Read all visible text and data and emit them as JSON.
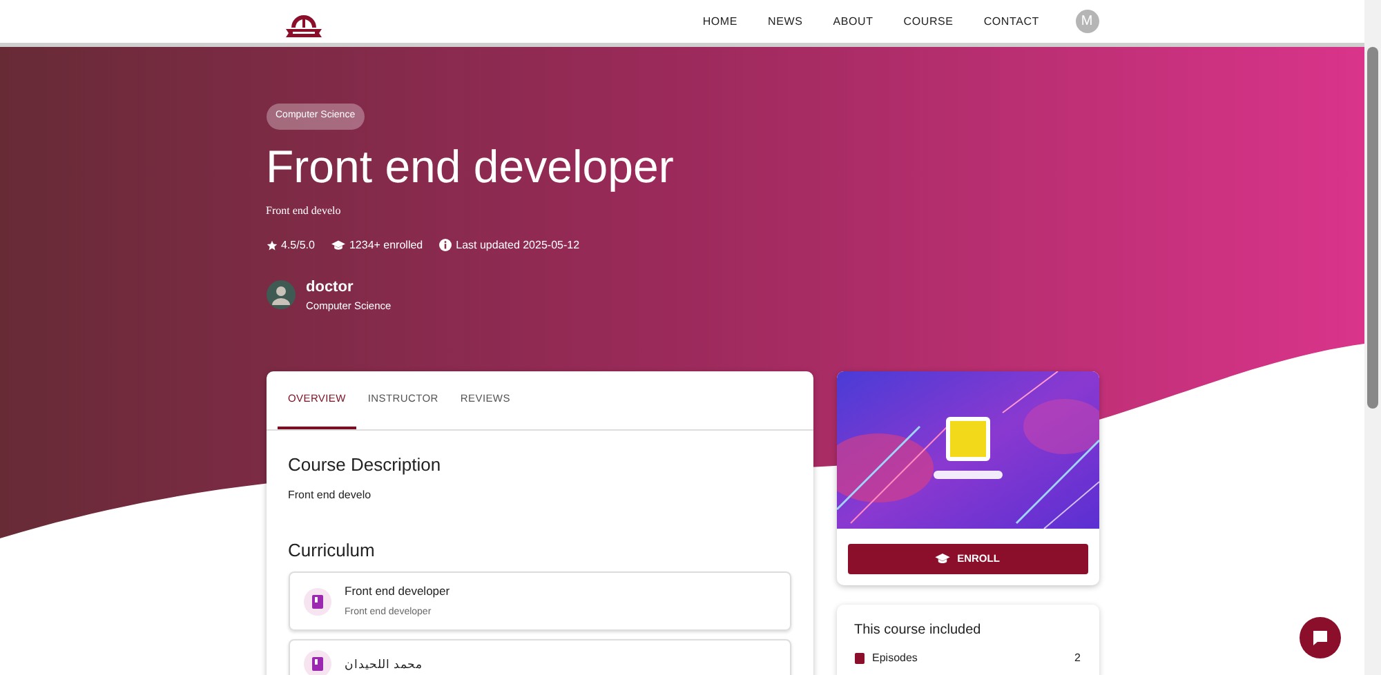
{
  "navbar": {
    "links": [
      {
        "label": "HOME"
      },
      {
        "label": "NEWS"
      },
      {
        "label": "ABOUT"
      },
      {
        "label": "COURSE"
      },
      {
        "label": "CONTACT"
      }
    ],
    "avatar": "M"
  },
  "hero": {
    "category": "Computer Science",
    "title": "Front end developer",
    "subtitle": "Front end develo",
    "rating": "4.5/5.0",
    "enrolled": "1234+ enrolled",
    "updated": "Last updated 2025-05-12",
    "instructor": {
      "name": "doctor",
      "department": "Computer Science"
    }
  },
  "tabs": [
    {
      "label": "OVERVIEW",
      "selected": true
    },
    {
      "label": "INSTRUCTOR",
      "selected": false
    },
    {
      "label": "REVIEWS",
      "selected": false
    }
  ],
  "overview": {
    "description_heading": "Course Description",
    "description": "Front end develo",
    "curriculum_heading": "Curriculum",
    "lessons": [
      {
        "title": "Front end developer",
        "subtitle": "Front end developer"
      },
      {
        "title": "محمد اللحيدان"
      }
    ]
  },
  "sidebar": {
    "enroll_button": "ENROLL",
    "included": {
      "heading": "This course included",
      "items": [
        {
          "label": "Episodes",
          "value": "2"
        }
      ]
    }
  }
}
